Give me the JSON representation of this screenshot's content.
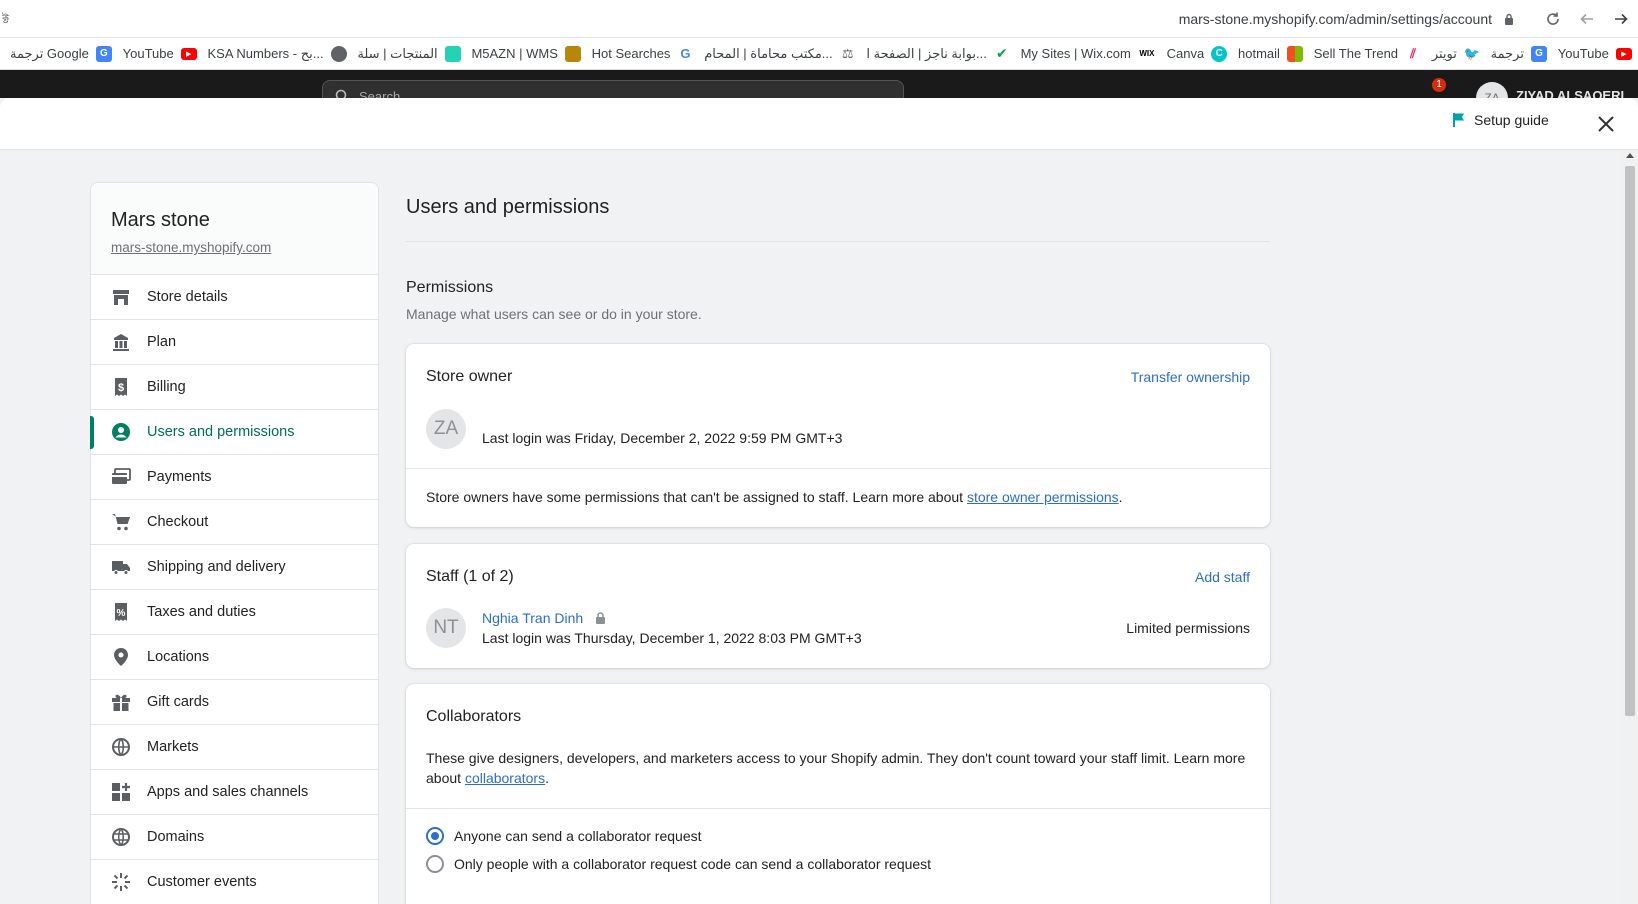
{
  "browser": {
    "url": "mars-stone.myshopify.com/admin/settings/account",
    "tab_glyph": "ক্ট",
    "bookmarks": [
      {
        "label": "ترجمة Google",
        "icon": "google-translate-icon",
        "color": "#4285f4"
      },
      {
        "label": "YouTube",
        "icon": "youtube-icon",
        "color": "#ff0000"
      },
      {
        "label": "KSA Numbers - بح...",
        "icon": "globe-icon",
        "color": "#5f6368"
      },
      {
        "label": "المنتجات | سلة",
        "icon": "salla-icon",
        "color": "#25d3b4"
      },
      {
        "label": "M5AZN | WMS",
        "icon": "warehouse-icon",
        "color": "#b8860b"
      },
      {
        "label": "Hot Searches",
        "icon": "google-icon",
        "color": "#4285f4"
      },
      {
        "label": "مكتب محاماة | المحام...",
        "icon": "scale-icon",
        "color": "#5f6368"
      },
      {
        "label": "بوابة ناجز | الصفحة ا...",
        "icon": "check-icon",
        "color": "#0a9e4f"
      },
      {
        "label": "My Sites | Wix.com",
        "icon": "wix-icon",
        "color": "#000000"
      },
      {
        "label": "Canva",
        "icon": "canva-icon",
        "color": "#00c4cc"
      },
      {
        "label": "hotmail",
        "icon": "microsoft-icon",
        "color": "#f25022"
      },
      {
        "label": "Sell The Trend",
        "icon": "trend-icon",
        "color": "#e91e63"
      },
      {
        "label": "تويتر",
        "icon": "twitter-icon",
        "color": "#1da1f2"
      },
      {
        "label": "ترجمة",
        "icon": "google-translate-icon",
        "color": "#4285f4"
      },
      {
        "label": "YouTube",
        "icon": "youtube-icon",
        "color": "#ff0000"
      }
    ]
  },
  "topbar": {
    "search_placeholder": "Search",
    "notification_count": "1",
    "user_initials": "ZA",
    "user_name": "ZIYAD ALSAQERI"
  },
  "modal": {
    "setup_guide_label": "Setup guide",
    "close_icon": "close-icon"
  },
  "sidebar": {
    "store_name": "Mars stone",
    "store_domain": "mars-stone.myshopify.com",
    "items": [
      {
        "label": "Store details",
        "icon": "store-icon"
      },
      {
        "label": "Plan",
        "icon": "plan-icon"
      },
      {
        "label": "Billing",
        "icon": "billing-icon"
      },
      {
        "label": "Users and permissions",
        "icon": "user-circle-icon",
        "active": true
      },
      {
        "label": "Payments",
        "icon": "payments-icon"
      },
      {
        "label": "Checkout",
        "icon": "cart-icon"
      },
      {
        "label": "Shipping and delivery",
        "icon": "truck-icon"
      },
      {
        "label": "Taxes and duties",
        "icon": "tax-icon"
      },
      {
        "label": "Locations",
        "icon": "location-icon"
      },
      {
        "label": "Gift cards",
        "icon": "gift-icon"
      },
      {
        "label": "Markets",
        "icon": "globe-icon"
      },
      {
        "label": "Apps and sales channels",
        "icon": "apps-icon"
      },
      {
        "label": "Domains",
        "icon": "domain-icon"
      },
      {
        "label": "Customer events",
        "icon": "sparkle-icon"
      }
    ]
  },
  "main": {
    "page_title": "Users and permissions",
    "permissions_title": "Permissions",
    "permissions_subtitle": "Manage what users can see or do in your store.",
    "store_owner": {
      "title": "Store owner",
      "action": "Transfer ownership",
      "initials": "ZA",
      "last_login": "Last login was Friday, December 2, 2022 9:59 PM GMT+3",
      "note_prefix": "Store owners have some permissions that can't be assigned to staff. Learn more about ",
      "note_link": "store owner permissions",
      "note_suffix": "."
    },
    "staff": {
      "title": "Staff (1 of 2)",
      "action": "Add staff",
      "member": {
        "initials": "NT",
        "name": "Nghia Tran Dinh",
        "last_login": "Last login was Thursday, December 1, 2022 8:03 PM GMT+3",
        "permissions": "Limited permissions"
      }
    },
    "collaborators": {
      "title": "Collaborators",
      "description_line1": "These give designers, developers, and marketers access to your Shopify admin. They don't count toward your staff limit. Learn more",
      "description_prefix2": "about ",
      "description_link": "collaborators",
      "description_suffix": ".",
      "options": [
        {
          "label": "Anyone can send a collaborator request",
          "selected": true
        },
        {
          "label": "Only people with a collaborator request code can send a collaborator request",
          "selected": false
        }
      ]
    }
  },
  "colors": {
    "accent": "#008060",
    "link": "#2c6ecb",
    "background": "#f1f2f3",
    "setup_flag": "#00a0ac"
  }
}
